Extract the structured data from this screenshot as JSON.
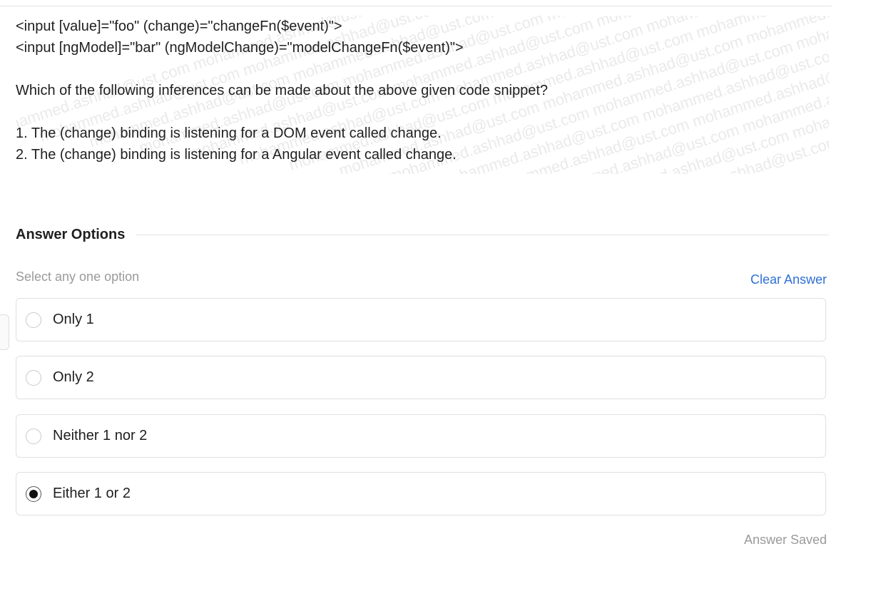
{
  "question": {
    "code_lines": [
      "<input [value]=\"foo\" (change)=\"changeFn($event)\">",
      "<input [ngModel]=\"bar\" (ngModelChange)=\"modelChangeFn($event)\">"
    ],
    "prompt": "Which of the following inferences can be made about the above given code snippet?",
    "statements": [
      "1. The (change) binding is listening for a DOM event called change.",
      "2. The (change) binding is listening for a Angular event called change."
    ],
    "watermark_text": "mohammed.ashhad@ust.com"
  },
  "answer_section": {
    "title": "Answer Options",
    "hint": "Select any one option",
    "clear_label": "Clear Answer",
    "saved_status": "Answer Saved"
  },
  "options": [
    {
      "label": "Only 1",
      "selected": false
    },
    {
      "label": "Only 2",
      "selected": false
    },
    {
      "label": "Neither 1 nor 2",
      "selected": false
    },
    {
      "label": "Either 1 or 2",
      "selected": true
    }
  ],
  "colors": {
    "accent_link": "#2f6fd6",
    "muted_text": "#9a9a9a",
    "border": "#e0e0e0",
    "watermark": "#eaeaea"
  }
}
